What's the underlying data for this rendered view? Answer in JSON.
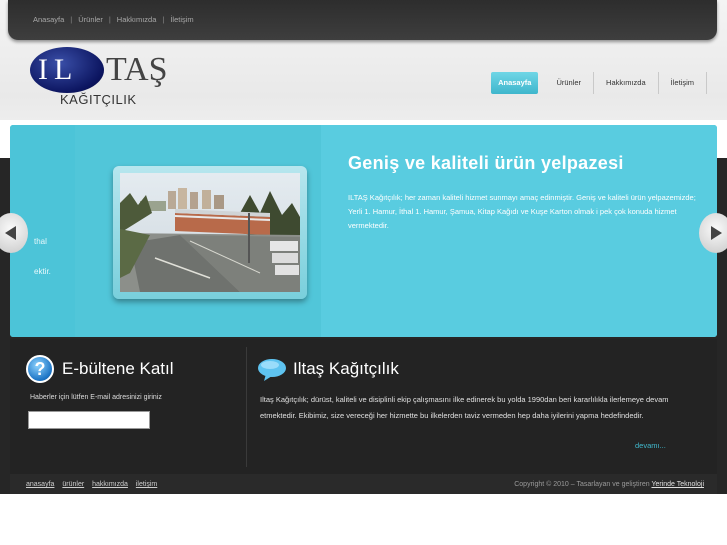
{
  "topnav": {
    "items": [
      "Anasayfa",
      "Ürünler",
      "Hakkımızda",
      "İletişim"
    ],
    "separator": "|"
  },
  "logo": {
    "letters": "IL",
    "name": "TAŞ",
    "subtitle": "KAĞITÇILIK"
  },
  "mainnav": {
    "items": [
      "Anasayfa",
      "Ürünler",
      "Hakkımızda",
      "İletişim"
    ],
    "active": "Anasayfa",
    "accent_color": "#4dc1d5"
  },
  "slider": {
    "title": "Geniş ve kaliteli ürün yelpazesi",
    "text": "ILTAŞ Kağıtçılık; her zaman kaliteli hizmet sunmayı amaç edinmiştir. Geniş ve kaliteli ürün yelpazemizde; Yerli 1. Hamur, İthal 1. Hamur, Şamua, Kitap Kağıdı ve Kuşe Karton olmak i pek çok konuda hizmet vermektedir.",
    "peek_line1": "thal",
    "peek_line2": "ektir.",
    "background_color": "#46bfd3",
    "prev_icon": "arrow-left-icon",
    "next_icon": "arrow-right-icon"
  },
  "newsletter": {
    "icon": "question-icon",
    "icon_glyph": "?",
    "title": "E-bültene Katıl",
    "label": "Haberler için lütfen E-mail adresinizi giriniz",
    "input_value": "",
    "input_placeholder": ""
  },
  "about": {
    "icon": "speech-bubble-icon",
    "title": "Iltaş Kağıtçılık",
    "text": "Iltaş Kağıtçılık; dürüst, kaliteli ve disiplinli ekip çalışmasını ilke edinerek bu yolda 1990dan beri kararlılıkla ilerlemeye devam etmektedir. Ekibimiz, size vereceği her hizmette bu ilkelerden taviz vermeden hep daha iyilerini yapma hedefindedir.",
    "more": "devamı..."
  },
  "footer": {
    "links": [
      "anasayfa",
      "ürünler",
      "hakkımızda",
      "iletişim"
    ],
    "copyright": "Copyright © 2010 – Tasarlayan ve geliştiren",
    "developer": "Yerinde Teknoloji"
  }
}
